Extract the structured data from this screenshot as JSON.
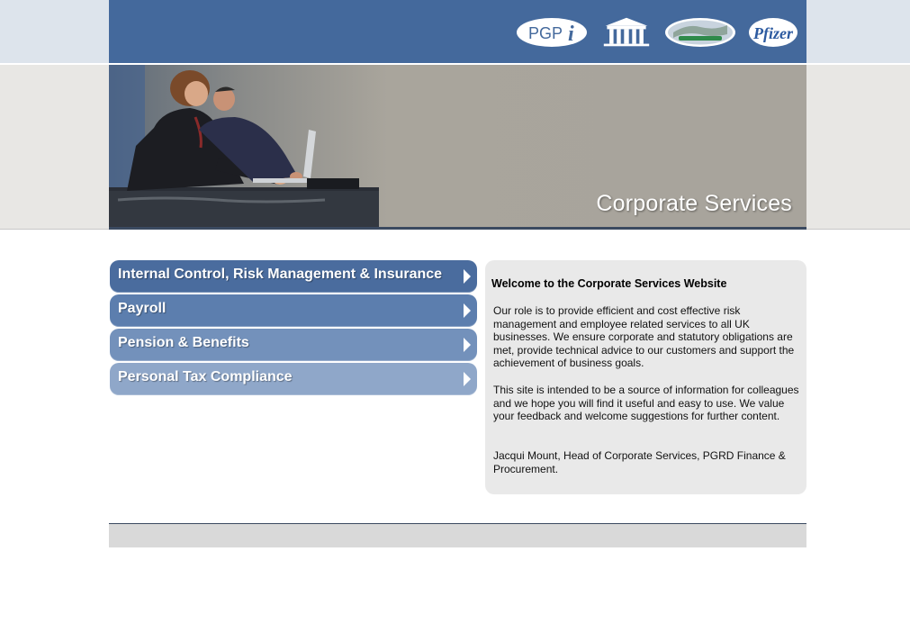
{
  "header": {
    "logos": [
      {
        "name": "PGPi",
        "text": "PGP",
        "suffix": "i"
      },
      {
        "name": "institution-building",
        "text": ""
      },
      {
        "name": "globe-badge",
        "text": ""
      },
      {
        "name": "Pfizer",
        "text": "Pfizer"
      }
    ],
    "colors": {
      "bar": "#44699c",
      "accent": "#3b4a60"
    }
  },
  "banner": {
    "title": "Corporate Services"
  },
  "nav": {
    "items": [
      {
        "label": "Internal Control, Risk Management & Insurance",
        "icon": "arrow-right-icon"
      },
      {
        "label": "Payroll",
        "icon": "arrow-right-icon"
      },
      {
        "label": "Pension & Benefits",
        "icon": "arrow-right-icon"
      },
      {
        "label": "Personal Tax Compliance",
        "icon": "arrow-right-icon"
      }
    ]
  },
  "welcome": {
    "title": "Welcome to the Corporate Services Website",
    "paragraphs": [
      "Our role is to provide efficient and cost effective risk management and employee related services to all UK businesses. We ensure corporate and statutory obligations are met, provide technical advice to our customers and support the achievement of business goals.",
      "This site is intended to be a source of information for colleagues and we hope you will find it useful and easy to use. We value your feedback and welcome suggestions for further content.",
      "Jacqui Mount, Head of Corporate Services, PGRD Finance & Procurement."
    ]
  }
}
